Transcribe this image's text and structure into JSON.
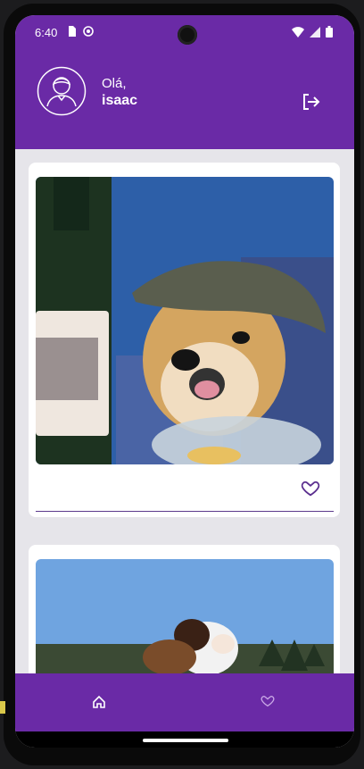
{
  "status_bar": {
    "time": "6:40"
  },
  "header": {
    "greeting": "Olá,",
    "username": "isaac"
  },
  "feed": {
    "posts": [
      {
        "image_icon": "dog-photo"
      },
      {
        "image_icon": "dog-photo"
      }
    ]
  },
  "colors": {
    "primary": "#6a2aa6",
    "background": "#e6e5ea",
    "card": "#ffffff"
  },
  "bottom_nav": {
    "items": [
      "home-icon",
      "heart-icon"
    ]
  }
}
